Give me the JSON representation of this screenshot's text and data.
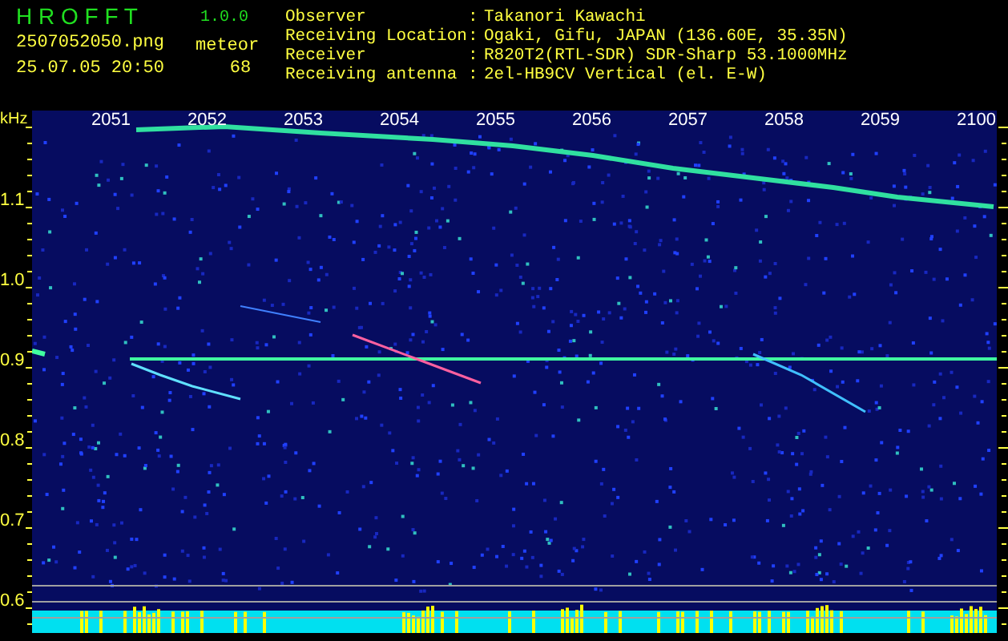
{
  "app": {
    "title": "H R O F F T",
    "version": "1.0.0",
    "filename": "2507052050.png",
    "datetime": "25.07.05 20:50",
    "count_label": "meteor",
    "count": "68"
  },
  "info": [
    {
      "label": "Observer",
      "separator": ":",
      "value": "Takanori Kawachi"
    },
    {
      "label": "Receiving Location",
      "separator": ":",
      "value": "Ogaki, Gifu, JAPAN (136.60E, 35.35N)"
    },
    {
      "label": "Receiver",
      "separator": ":",
      "value": "R820T2(RTL-SDR) SDR-Sharp 53.1000MHz"
    },
    {
      "label": "Receiving antenna",
      "separator": ":",
      "value": "2el-HB9CV Vertical (el. E-W)"
    }
  ],
  "spectrogram": {
    "unit": "kHz",
    "y_labels": [
      "1.1",
      "1.0",
      "0.9",
      "0.8",
      "0.7",
      "0.6"
    ],
    "time_labels": [
      "2051",
      "2052",
      "2053",
      "2054",
      "2055",
      "2056",
      "2057",
      "2058",
      "2059",
      "2100"
    ]
  }
}
